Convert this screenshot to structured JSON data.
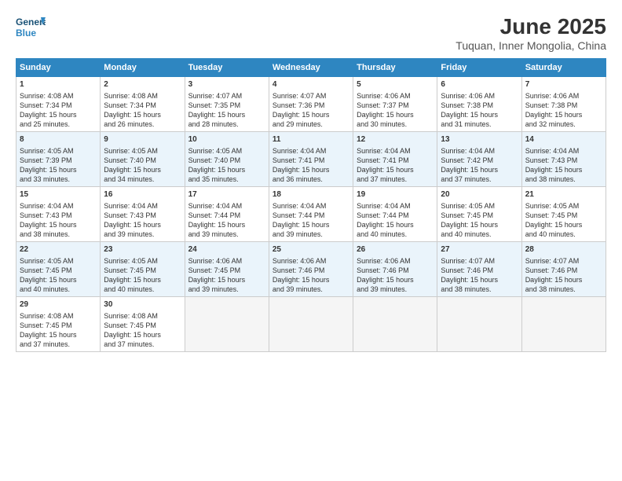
{
  "header": {
    "logo_general": "General",
    "logo_blue": "Blue",
    "title": "June 2025",
    "subtitle": "Tuquan, Inner Mongolia, China"
  },
  "days_of_week": [
    "Sunday",
    "Monday",
    "Tuesday",
    "Wednesday",
    "Thursday",
    "Friday",
    "Saturday"
  ],
  "weeks": [
    [
      {
        "day": 1,
        "lines": [
          "Sunrise: 4:08 AM",
          "Sunset: 7:34 PM",
          "Daylight: 15 hours",
          "and 25 minutes."
        ]
      },
      {
        "day": 2,
        "lines": [
          "Sunrise: 4:08 AM",
          "Sunset: 7:34 PM",
          "Daylight: 15 hours",
          "and 26 minutes."
        ]
      },
      {
        "day": 3,
        "lines": [
          "Sunrise: 4:07 AM",
          "Sunset: 7:35 PM",
          "Daylight: 15 hours",
          "and 28 minutes."
        ]
      },
      {
        "day": 4,
        "lines": [
          "Sunrise: 4:07 AM",
          "Sunset: 7:36 PM",
          "Daylight: 15 hours",
          "and 29 minutes."
        ]
      },
      {
        "day": 5,
        "lines": [
          "Sunrise: 4:06 AM",
          "Sunset: 7:37 PM",
          "Daylight: 15 hours",
          "and 30 minutes."
        ]
      },
      {
        "day": 6,
        "lines": [
          "Sunrise: 4:06 AM",
          "Sunset: 7:38 PM",
          "Daylight: 15 hours",
          "and 31 minutes."
        ]
      },
      {
        "day": 7,
        "lines": [
          "Sunrise: 4:06 AM",
          "Sunset: 7:38 PM",
          "Daylight: 15 hours",
          "and 32 minutes."
        ]
      }
    ],
    [
      {
        "day": 8,
        "lines": [
          "Sunrise: 4:05 AM",
          "Sunset: 7:39 PM",
          "Daylight: 15 hours",
          "and 33 minutes."
        ]
      },
      {
        "day": 9,
        "lines": [
          "Sunrise: 4:05 AM",
          "Sunset: 7:40 PM",
          "Daylight: 15 hours",
          "and 34 minutes."
        ]
      },
      {
        "day": 10,
        "lines": [
          "Sunrise: 4:05 AM",
          "Sunset: 7:40 PM",
          "Daylight: 15 hours",
          "and 35 minutes."
        ]
      },
      {
        "day": 11,
        "lines": [
          "Sunrise: 4:04 AM",
          "Sunset: 7:41 PM",
          "Daylight: 15 hours",
          "and 36 minutes."
        ]
      },
      {
        "day": 12,
        "lines": [
          "Sunrise: 4:04 AM",
          "Sunset: 7:41 PM",
          "Daylight: 15 hours",
          "and 37 minutes."
        ]
      },
      {
        "day": 13,
        "lines": [
          "Sunrise: 4:04 AM",
          "Sunset: 7:42 PM",
          "Daylight: 15 hours",
          "and 37 minutes."
        ]
      },
      {
        "day": 14,
        "lines": [
          "Sunrise: 4:04 AM",
          "Sunset: 7:43 PM",
          "Daylight: 15 hours",
          "and 38 minutes."
        ]
      }
    ],
    [
      {
        "day": 15,
        "lines": [
          "Sunrise: 4:04 AM",
          "Sunset: 7:43 PM",
          "Daylight: 15 hours",
          "and 38 minutes."
        ]
      },
      {
        "day": 16,
        "lines": [
          "Sunrise: 4:04 AM",
          "Sunset: 7:43 PM",
          "Daylight: 15 hours",
          "and 39 minutes."
        ]
      },
      {
        "day": 17,
        "lines": [
          "Sunrise: 4:04 AM",
          "Sunset: 7:44 PM",
          "Daylight: 15 hours",
          "and 39 minutes."
        ]
      },
      {
        "day": 18,
        "lines": [
          "Sunrise: 4:04 AM",
          "Sunset: 7:44 PM",
          "Daylight: 15 hours",
          "and 39 minutes."
        ]
      },
      {
        "day": 19,
        "lines": [
          "Sunrise: 4:04 AM",
          "Sunset: 7:44 PM",
          "Daylight: 15 hours",
          "and 40 minutes."
        ]
      },
      {
        "day": 20,
        "lines": [
          "Sunrise: 4:05 AM",
          "Sunset: 7:45 PM",
          "Daylight: 15 hours",
          "and 40 minutes."
        ]
      },
      {
        "day": 21,
        "lines": [
          "Sunrise: 4:05 AM",
          "Sunset: 7:45 PM",
          "Daylight: 15 hours",
          "and 40 minutes."
        ]
      }
    ],
    [
      {
        "day": 22,
        "lines": [
          "Sunrise: 4:05 AM",
          "Sunset: 7:45 PM",
          "Daylight: 15 hours",
          "and 40 minutes."
        ]
      },
      {
        "day": 23,
        "lines": [
          "Sunrise: 4:05 AM",
          "Sunset: 7:45 PM",
          "Daylight: 15 hours",
          "and 40 minutes."
        ]
      },
      {
        "day": 24,
        "lines": [
          "Sunrise: 4:06 AM",
          "Sunset: 7:45 PM",
          "Daylight: 15 hours",
          "and 39 minutes."
        ]
      },
      {
        "day": 25,
        "lines": [
          "Sunrise: 4:06 AM",
          "Sunset: 7:46 PM",
          "Daylight: 15 hours",
          "and 39 minutes."
        ]
      },
      {
        "day": 26,
        "lines": [
          "Sunrise: 4:06 AM",
          "Sunset: 7:46 PM",
          "Daylight: 15 hours",
          "and 39 minutes."
        ]
      },
      {
        "day": 27,
        "lines": [
          "Sunrise: 4:07 AM",
          "Sunset: 7:46 PM",
          "Daylight: 15 hours",
          "and 38 minutes."
        ]
      },
      {
        "day": 28,
        "lines": [
          "Sunrise: 4:07 AM",
          "Sunset: 7:46 PM",
          "Daylight: 15 hours",
          "and 38 minutes."
        ]
      }
    ],
    [
      {
        "day": 29,
        "lines": [
          "Sunrise: 4:08 AM",
          "Sunset: 7:45 PM",
          "Daylight: 15 hours",
          "and 37 minutes."
        ]
      },
      {
        "day": 30,
        "lines": [
          "Sunrise: 4:08 AM",
          "Sunset: 7:45 PM",
          "Daylight: 15 hours",
          "and 37 minutes."
        ]
      },
      {
        "day": null,
        "lines": []
      },
      {
        "day": null,
        "lines": []
      },
      {
        "day": null,
        "lines": []
      },
      {
        "day": null,
        "lines": []
      },
      {
        "day": null,
        "lines": []
      }
    ]
  ]
}
